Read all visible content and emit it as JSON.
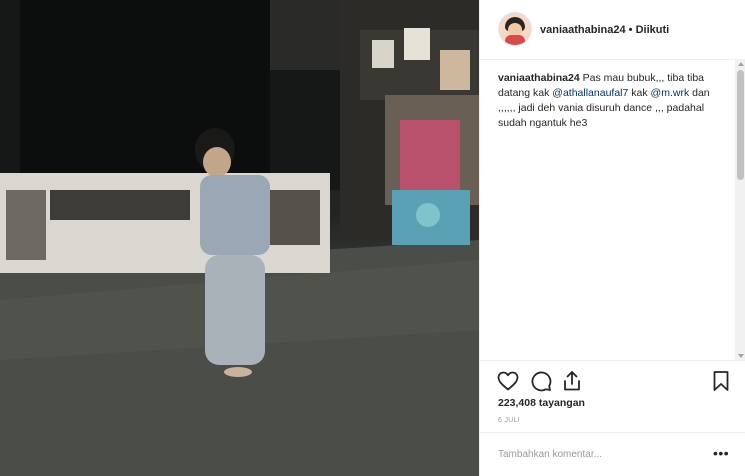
{
  "post": {
    "username": "vaniaathabina24",
    "separator": " • ",
    "follow_status": "Diikuti",
    "caption": {
      "username": "vaniaathabina24",
      "part1": " Pas mau bubuk,,, tiba tiba datang kak ",
      "mention1": "@athallanaufal7",
      "part2": " kak ",
      "mention2": "@m.wrk",
      "part3": " dan ,,,,,, jadi deh vania disuruh dance ,,, padahal sudah ngantuk he3"
    },
    "views": "223,408 tayangan",
    "date": "6 JULI",
    "comment_placeholder": "Tambahkan komentar...",
    "more_label": "•••"
  },
  "icons": {
    "like": "heart-icon",
    "comment": "comment-icon",
    "share": "share-icon",
    "save": "bookmark-icon"
  }
}
